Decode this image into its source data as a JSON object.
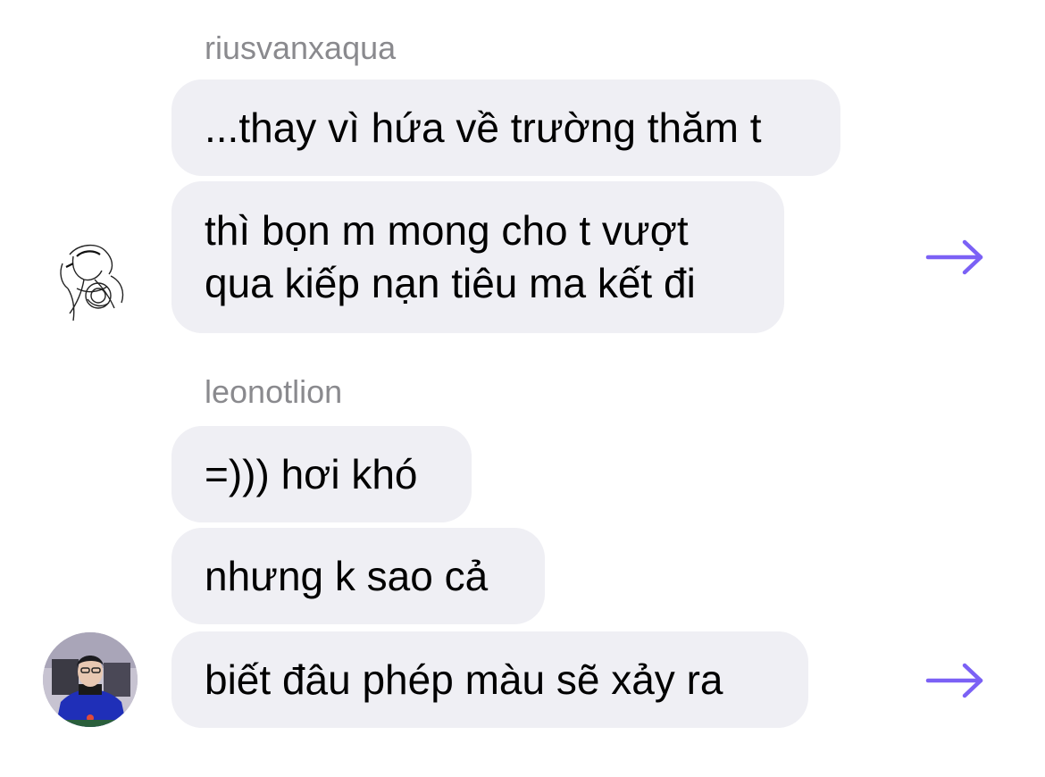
{
  "conversation": {
    "groups": [
      {
        "sender": "riusvanxaqua",
        "messages": [
          {
            "lines": [
              "...thay vì hứa về trường thăm t"
            ]
          },
          {
            "lines": [
              "thì bọn m mong cho t vượt",
              "qua kiếp nạn tiêu ma kết đi"
            ]
          }
        ],
        "avatar_icon": "sketch-avatar-icon"
      },
      {
        "sender": "leonotlion",
        "messages": [
          {
            "lines": [
              "=))) hơi khó"
            ]
          },
          {
            "lines": [
              "nhưng k sao cả"
            ]
          },
          {
            "lines": [
              "biết đâu phép màu sẽ xảy ra"
            ]
          }
        ],
        "avatar_icon": "photo-avatar-icon"
      }
    ]
  },
  "icons": {
    "share": "arrow-right-icon"
  },
  "colors": {
    "bubble": "#efeff4",
    "sender_name": "#8a8a8e",
    "share_arrow": "#7b61f5",
    "text": "#000000"
  }
}
